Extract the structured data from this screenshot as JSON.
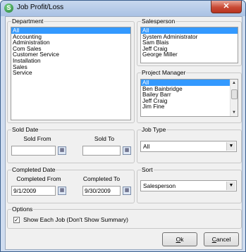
{
  "window": {
    "title": "Job Profit/Loss",
    "close_glyph": "✕"
  },
  "department": {
    "title": "Department",
    "items": [
      "All",
      "Accounting",
      "Administration",
      "Com Sales",
      "Customer Service",
      "Installation",
      "Sales",
      "Service"
    ],
    "selected": "All"
  },
  "salesperson": {
    "title": "Salesperson",
    "items": [
      "All",
      "System Administrator",
      "Sam Blais",
      "Jeff Craig",
      "George Miller"
    ],
    "selected": "All"
  },
  "project_manager": {
    "title": "Project Manager",
    "items": [
      "All",
      "Ben Bainbridge",
      "Bailey Barr",
      "Jeff Craig",
      "Jim Fine"
    ],
    "selected": "All"
  },
  "sold_date": {
    "title": "Sold Date",
    "from_label": "Sold From",
    "to_label": "Sold To",
    "from_value": "",
    "to_value": ""
  },
  "job_type": {
    "title": "Job Type",
    "value": "All"
  },
  "completed_date": {
    "title": "Completed Date",
    "from_label": "Completed From",
    "to_label": "Completed To",
    "from_value": "9/1/2009",
    "to_value": "9/30/2009"
  },
  "sort": {
    "title": "Sort",
    "value": "Salesperson"
  },
  "options": {
    "title": "Options",
    "show_each_job_label": "Show Each Job (Don't Show Summary)",
    "show_each_job_checked": true
  },
  "buttons": {
    "ok_u": "O",
    "ok_rest": "k",
    "cancel_u": "C",
    "cancel_rest": "ancel"
  },
  "icons": {
    "calendar": "calendar-icon",
    "dropdown": "chevron-down-icon"
  }
}
